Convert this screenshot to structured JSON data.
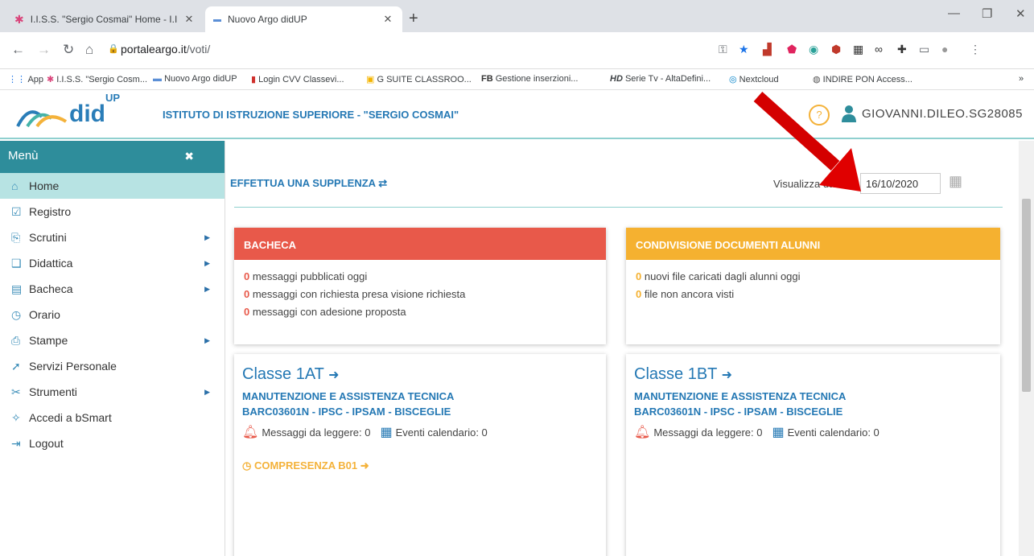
{
  "browser": {
    "tabs": [
      {
        "title": "I.I.S.S. \"Sergio Cosmai\" Home - I.I",
        "close": "✕"
      },
      {
        "title": "Nuovo Argo didUP",
        "close": "✕"
      }
    ],
    "new_tab": "+",
    "url_host": "portaleargo.it",
    "url_path": "/voti/",
    "bookmarks": [
      "App",
      "I.I.S.S. \"Sergio Cosm...",
      "Nuovo Argo didUP",
      "Login CVV Classevi...",
      "G SUITE CLASSROO...",
      "Gestione inserzioni...",
      "Serie Tv - AltaDefini...",
      "Nextcloud",
      "INDIRE PON Access..."
    ],
    "bookmarks_overflow": "»"
  },
  "header": {
    "logo": "did",
    "logo_sup": "UP",
    "school": "ISTITUTO DI ISTRUZIONE SUPERIORE - \"SERGIO COSMAI\"",
    "help": "?",
    "user": "GIOVANNI.DILEO.SG28085"
  },
  "sidebar": {
    "title": "Menù",
    "close": "✖",
    "items": [
      {
        "label": "Home",
        "icon": "⌂"
      },
      {
        "label": "Registro",
        "icon": "☑"
      },
      {
        "label": "Scrutini",
        "icon": "⎘"
      },
      {
        "label": "Didattica",
        "icon": "❑"
      },
      {
        "label": "Bacheca",
        "icon": "▤"
      },
      {
        "label": "Orario",
        "icon": "◷"
      },
      {
        "label": "Stampe",
        "icon": "⎙"
      },
      {
        "label": "Servizi Personale",
        "icon": "➚"
      },
      {
        "label": "Strumenti",
        "icon": "✂"
      },
      {
        "label": "Accedi a bSmart",
        "icon": "✧"
      },
      {
        "label": "Logout",
        "icon": "⇥"
      }
    ]
  },
  "main": {
    "supplenza": "EFFETTUA UNA SUPPLENZA",
    "vis_label": "Visualizza dati al:",
    "date": "16/10/2020",
    "bacheca": {
      "title": "BACHECA",
      "color": "#e8594a",
      "rows": [
        {
          "num": "0",
          "text": " messaggi pubblicati oggi"
        },
        {
          "num": "0",
          "text": " messaggi con richiesta presa visione richiesta"
        },
        {
          "num": "0",
          "text": " messaggi con adesione proposta"
        }
      ]
    },
    "condivisione": {
      "title": "CONDIVISIONE DOCUMENTI ALUNNI",
      "color": "#f5b130",
      "rows": [
        {
          "num": "0",
          "text": " nuovi file caricati dagli alunni oggi"
        },
        {
          "num": "0",
          "text": " file non ancora visti"
        }
      ]
    },
    "classes": [
      {
        "title": "Classe 1AT",
        "course": "MANUTENZIONE E ASSISTENZA TECNICA",
        "school": "BARC03601N - IPSC - IPSAM - BISCEGLIE",
        "messages": "Messaggi da leggere: 0",
        "events": "Eventi calendario: 0",
        "compresenza": "COMPRESENZA B01"
      },
      {
        "title": "Classe 1BT",
        "course": "MANUTENZIONE E ASSISTENZA TECNICA",
        "school": "BARC03601N - IPSC - IPSAM - BISCEGLIE",
        "messages": "Messaggi da leggere: 0",
        "events": "Eventi calendario: 0"
      }
    ]
  }
}
